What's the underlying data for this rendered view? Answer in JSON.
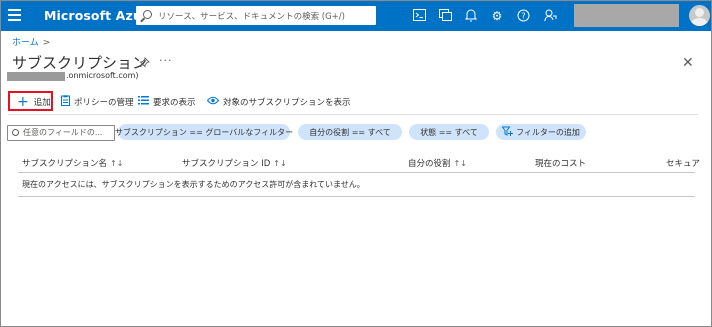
{
  "topbar": {
    "brand": "Microsoft Azure",
    "search_placeholder": "リソース、サービス、ドキュメントの検索 (G+/)",
    "icons": [
      "cloud-shell-icon",
      "directory-filter-icon",
      "notifications-icon",
      "settings-icon",
      "help-icon",
      "feedback-icon"
    ]
  },
  "breadcrumb": {
    "home": "ホーム",
    "separator": ">"
  },
  "page": {
    "title": "サブスクリプション",
    "tenant_suffix": ".onmicrosoft.com)"
  },
  "toolbar": {
    "add": "追加",
    "policy": "ポリシーの管理",
    "requirements": "要求の表示",
    "show_target": "対象のサブスクリプションを表示"
  },
  "filters": {
    "search_placeholder": "任意のフィールドの...",
    "pills": [
      "サブスクリプション == グローバルなフィルター",
      "自分の役割 == すべて",
      "状態 == すべて"
    ],
    "add_filter": "フィルターの追加"
  },
  "table": {
    "columns": [
      "サブスクリプション名",
      "サブスクリプション ID",
      "自分の役割",
      "現在のコスト",
      "セキュア"
    ],
    "sort_glyph": "↑↓",
    "empty_message": "現在のアクセスには、サブスクリプションを表示するためのアクセス許可が含まれていません。"
  },
  "colors": {
    "brand_blue": "#0072c6",
    "accent": "#0078d4",
    "pill_bg": "#cfe4fa",
    "highlight_red": "#e81123"
  }
}
